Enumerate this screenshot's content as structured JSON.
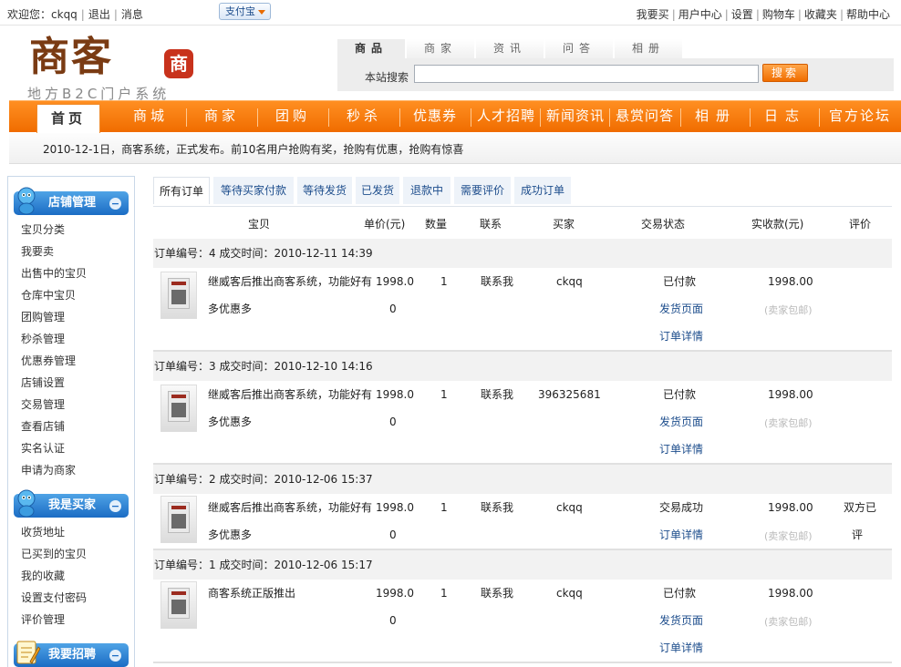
{
  "topbar": {
    "welcome_label": "欢迎您：",
    "username": "ckqq",
    "logout": "退出",
    "messages": "消息",
    "alipay_label": "支付宝",
    "links": [
      "我要买",
      "用户中心",
      "设置",
      "购物车",
      "收藏夹",
      "帮助中心"
    ]
  },
  "logo": {
    "name": "商客",
    "seal": "商",
    "tagline": "地方B2C门户系统"
  },
  "search": {
    "tabs": [
      "商品",
      "商家",
      "资讯",
      "问答",
      "相册"
    ],
    "active_tab": 0,
    "label": "本站搜索",
    "value": "",
    "button": "搜索"
  },
  "nav": {
    "items": [
      "首页",
      "商城",
      "商家",
      "团购",
      "秒杀",
      "优惠券",
      "人才招聘",
      "新闻资讯",
      "悬赏问答",
      "相册",
      "日志",
      "官方论坛"
    ],
    "active": 0
  },
  "notice": "2010-12-1日，商客系统，正式发布。前10名用户抢购有奖，抢购有优惠，抢购有惊喜",
  "sidebar": {
    "sections": [
      {
        "title": "店铺管理",
        "items": [
          "宝贝分类",
          "我要卖",
          "出售中的宝贝",
          "仓库中宝贝",
          "团购管理",
          "秒杀管理",
          "优惠券管理",
          "店铺设置",
          "交易管理",
          "查看店铺",
          "实名认证",
          "申请为商家"
        ]
      },
      {
        "title": "我是买家",
        "items": [
          "收货地址",
          "已买到的宝贝",
          "我的收藏",
          "设置支付密码",
          "评价管理"
        ]
      },
      {
        "title": "我要招聘",
        "items": []
      }
    ]
  },
  "order_tabs": [
    "所有订单",
    "等待买家付款",
    "等待发货",
    "已发货",
    "退款中",
    "需要评价",
    "成功订单"
  ],
  "columns": [
    "宝贝",
    "单价(元)",
    "数量",
    "联系",
    "买家",
    "交易状态",
    "实收款(元)",
    "评价"
  ],
  "orders": [
    {
      "header": "订单编号：4 成交时间：2010-12-11 14:39",
      "title_lines": [
        "继威客后推出商客系统，功能好有",
        "多优惠多"
      ],
      "price_lines": [
        "1998.0",
        "0"
      ],
      "qty": "1",
      "contact": "联系我",
      "buyer": "ckqq",
      "status": [
        "已付款",
        "发货页面",
        "订单详情"
      ],
      "amount": "1998.00",
      "shipping": "(卖家包邮)",
      "review": []
    },
    {
      "header": "订单编号：3 成交时间：2010-12-10 14:16",
      "title_lines": [
        "继威客后推出商客系统，功能好有",
        "多优惠多"
      ],
      "price_lines": [
        "1998.0",
        "0"
      ],
      "qty": "1",
      "contact": "联系我",
      "buyer": "396325681",
      "status": [
        "已付款",
        "发货页面",
        "订单详情"
      ],
      "amount": "1998.00",
      "shipping": "(卖家包邮)",
      "review": []
    },
    {
      "header": "订单编号：2 成交时间：2010-12-06 15:37",
      "title_lines": [
        "继威客后推出商客系统，功能好有",
        "多优惠多"
      ],
      "price_lines": [
        "1998.0",
        "0"
      ],
      "qty": "1",
      "contact": "联系我",
      "buyer": "ckqq",
      "status": [
        "交易成功",
        "订单详情"
      ],
      "amount": "1998.00",
      "shipping": "(卖家包邮)",
      "review": [
        "双方已",
        "评"
      ]
    },
    {
      "header": "订单编号：1 成交时间：2010-12-06 15:17",
      "title_lines": [
        "商客系统正版推出",
        ""
      ],
      "price_lines": [
        "1998.0",
        "0"
      ],
      "qty": "1",
      "contact": "联系我",
      "buyer": "ckqq",
      "status": [
        "已付款",
        "发货页面",
        "订单详情"
      ],
      "amount": "1998.00",
      "shipping": "(卖家包邮)",
      "review": []
    }
  ]
}
